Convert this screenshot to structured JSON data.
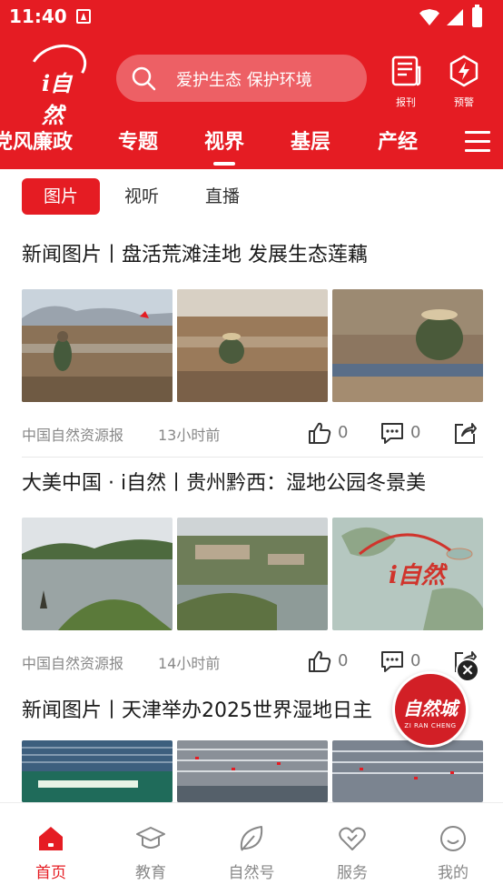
{
  "status_bar": {
    "time": "11:40"
  },
  "header": {
    "logo_text": "i自然",
    "search": {
      "placeholder": "爱护生态 保护环境"
    },
    "buttons": [
      {
        "label": "报刊",
        "icon": "newspaper-icon"
      },
      {
        "label": "预警",
        "icon": "warning-bolt-icon"
      }
    ]
  },
  "nav": {
    "tabs": [
      {
        "label": "党风廉政",
        "active": false
      },
      {
        "label": "专题",
        "active": false
      },
      {
        "label": "视界",
        "active": true
      },
      {
        "label": "基层",
        "active": false
      },
      {
        "label": "产经",
        "active": false
      }
    ]
  },
  "sub_tabs": [
    {
      "label": "图片",
      "active": true
    },
    {
      "label": "视听",
      "active": false
    },
    {
      "label": "直播",
      "active": false
    }
  ],
  "articles": [
    {
      "title": "新闻图片丨盘活荒滩洼地  发展生态莲藕",
      "source": "中国自然资源报",
      "time": "13小时前",
      "likes": "0",
      "comments": "0"
    },
    {
      "title": "大美中国 · i自然丨贵州黔西：湿地公园冬景美",
      "source": "中国自然资源报",
      "time": "14小时前",
      "likes": "0",
      "comments": "0"
    },
    {
      "title": "新闻图片丨天津举办2025世界湿地日主"
    }
  ],
  "float_badge": {
    "title": "自然城",
    "subtitle": "ZI RAN CHENG"
  },
  "bottom_nav": [
    {
      "label": "首页",
      "icon": "home-icon",
      "active": true
    },
    {
      "label": "教育",
      "icon": "graduation-cap-icon",
      "active": false
    },
    {
      "label": "自然号",
      "icon": "leaf-icon",
      "active": false
    },
    {
      "label": "服务",
      "icon": "heart-icon",
      "active": false
    },
    {
      "label": "我的",
      "icon": "smiley-icon",
      "active": false
    }
  ],
  "colors": {
    "brand_red": "#e51c23"
  }
}
